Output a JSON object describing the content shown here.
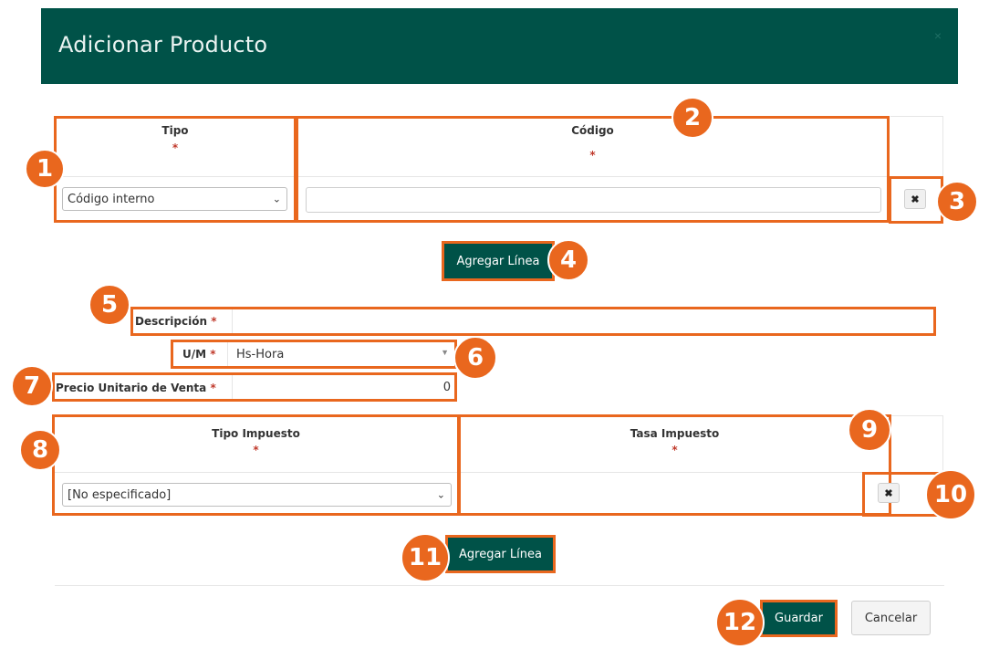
{
  "dialog": {
    "title": "Adicionar Producto",
    "close_glyph": "×"
  },
  "codes_table": {
    "col_tipo": "Tipo",
    "col_codigo": "Código",
    "required_mark": "*",
    "tipo_value": "Código interno",
    "codigo_value": "",
    "remove_glyph": "✖"
  },
  "add_line_button_1": "Agregar Línea",
  "form": {
    "descripcion_label": "Descripción",
    "descripcion_value": "",
    "um_label": "U/M",
    "um_value": "Hs-Hora",
    "precio_label": "Precio Unitario de Venta",
    "precio_value": "0",
    "required_mark": "*"
  },
  "tax_table": {
    "col_tipo_impuesto": "Tipo Impuesto",
    "col_tasa_impuesto": "Tasa Impuesto",
    "required_mark": "*",
    "tipo_impuesto_value": "[No especificado]",
    "remove_glyph": "✖"
  },
  "add_line_button_2": "Agregar Línea",
  "footer": {
    "save_label": "Guardar",
    "cancel_label": "Cancelar"
  },
  "badges": [
    "1",
    "2",
    "3",
    "4",
    "5",
    "6",
    "7",
    "8",
    "9",
    "10",
    "11",
    "12"
  ],
  "colors": {
    "header": "#005248",
    "accent": "#e9671e",
    "button": "#005248"
  }
}
